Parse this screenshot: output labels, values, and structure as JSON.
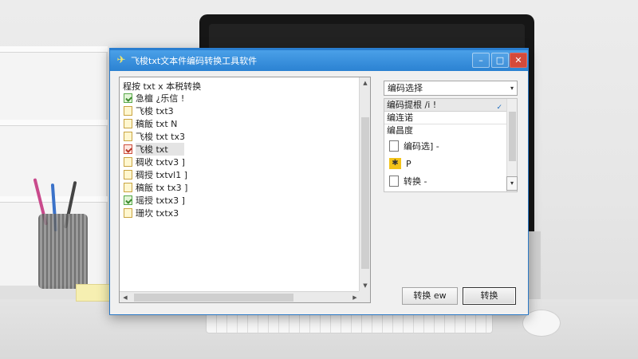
{
  "window": {
    "title": "飞梭txt文本件编码转换工具软件",
    "controls": {
      "minimize": "–",
      "maximize": "□",
      "close": "✕"
    }
  },
  "file_pane": {
    "header": "程按 txt x 本税转换",
    "files": [
      {
        "name": "急檀 ¿乐信 !",
        "icon": "file-green-icon"
      },
      {
        "name": "飞梭 txt3",
        "icon": "file-icon"
      },
      {
        "name": "稿飯 txt N",
        "icon": "file-icon"
      },
      {
        "name": "飞梭 txt tx3",
        "icon": "file-icon"
      },
      {
        "name": "飞梭 txt",
        "icon": "file-red-icon",
        "selected": true
      },
      {
        "name": "稠收 txtv3 ]",
        "icon": "file-icon"
      },
      {
        "name": "稠授 txtvl1 ]",
        "icon": "file-icon"
      },
      {
        "name": "稿飯 tx tx3 ]",
        "icon": "file-icon"
      },
      {
        "name": "瑶授 txtx3 ]",
        "icon": "file-green-icon"
      },
      {
        "name": "珊坎 txtx3",
        "icon": "file-icon"
      }
    ],
    "scroll_up": "▲",
    "scroll_down": "▼",
    "scroll_left": "◀",
    "scroll_right": "▶"
  },
  "encoding": {
    "dropdown_value": "编码选择",
    "dropdown_caret": "▾",
    "options": [
      {
        "label": "编码提根 /i !",
        "highlighted": true,
        "check": "✓"
      },
      {
        "label": "编连诺"
      },
      {
        "label": "编昌度"
      }
    ],
    "modes": [
      {
        "label": "编码选] -",
        "icon": "file-icon"
      },
      {
        "label": "P",
        "icon": "star-icon",
        "glyph": "✱"
      },
      {
        "label": "转换 -",
        "icon": "file-icon"
      }
    ],
    "small_caret": "▾"
  },
  "buttons": {
    "secondary": "转换 ew",
    "primary": "转换"
  },
  "colors": {
    "titlebar": "#2b82d2",
    "close": "#d44a3a",
    "selection": "#e4e4e4"
  }
}
